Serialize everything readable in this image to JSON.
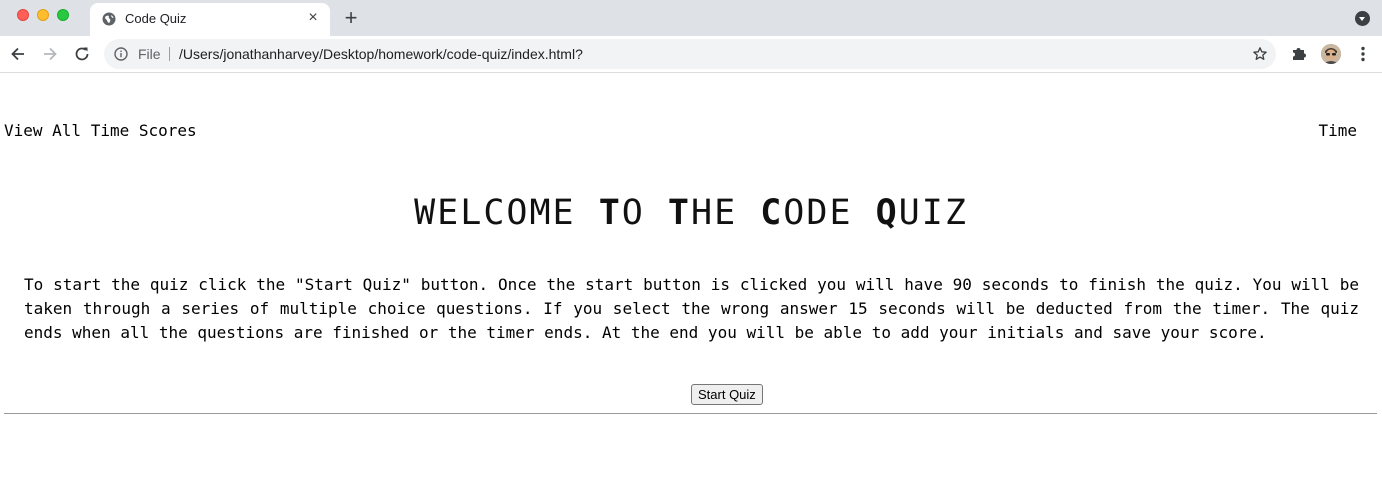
{
  "browser": {
    "tab_title": "Code Quiz",
    "new_tab_label": "+",
    "close_tab_label": "×",
    "omnibox": {
      "scheme_label": "File",
      "url": "/Users/jonathanharvey/Desktop/homework/code-quiz/index.html?"
    }
  },
  "header": {
    "view_scores_label": "View All Time Scores",
    "time_label": "Time"
  },
  "main": {
    "title_parts": [
      {
        "text": "W",
        "bold": false
      },
      {
        "text": "ELCOME ",
        "bold": false
      },
      {
        "text": "T",
        "bold": true
      },
      {
        "text": "O ",
        "bold": false
      },
      {
        "text": "T",
        "bold": true
      },
      {
        "text": "HE ",
        "bold": false
      },
      {
        "text": "C",
        "bold": true
      },
      {
        "text": "ODE ",
        "bold": false
      },
      {
        "text": "Q",
        "bold": true
      },
      {
        "text": "UIZ",
        "bold": false
      }
    ],
    "intro": "To start the quiz click the \"Start Quiz\" button. Once the start button is clicked you will have 90 seconds to finish the quiz. You will be taken through a series of multiple choice questions. If you select the wrong answer 15 seconds will be deducted from the timer. The quiz ends when all the questions are finished or the timer ends. At the end you will be able to add your initials and save your score.",
    "start_button_label": "Start Quiz"
  }
}
